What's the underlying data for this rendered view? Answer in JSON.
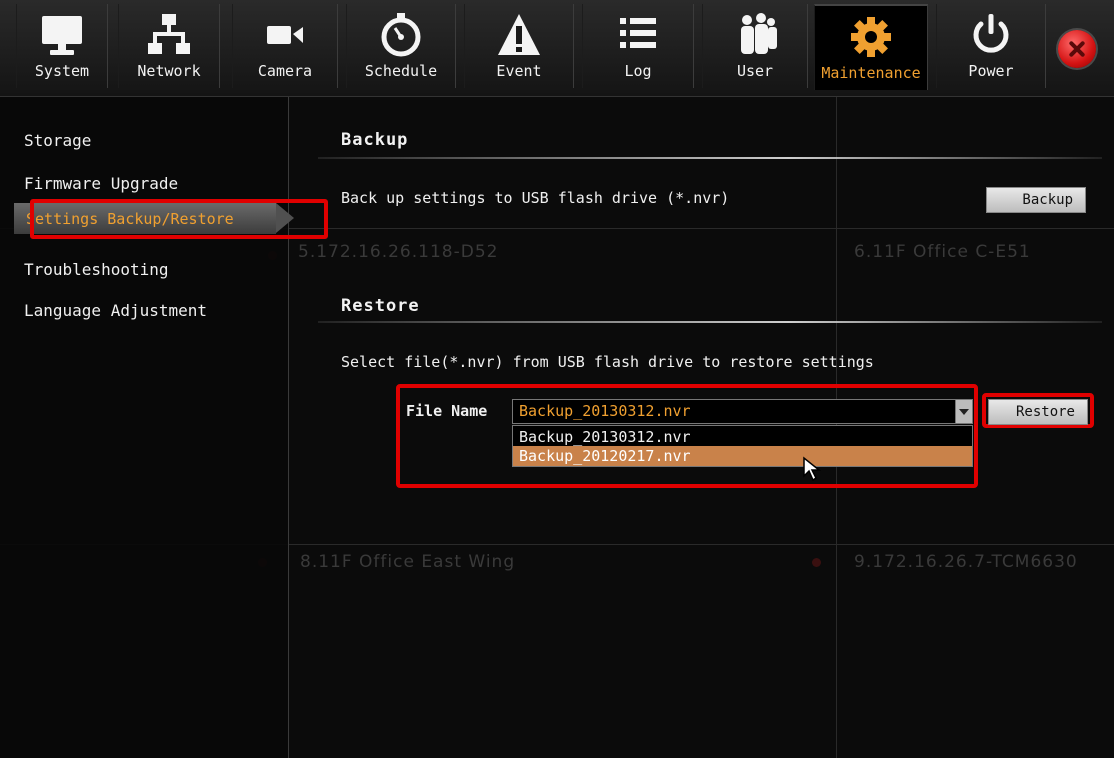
{
  "toolbar": {
    "items": [
      {
        "label": "System",
        "icon": "monitor-icon"
      },
      {
        "label": "Network",
        "icon": "network-icon"
      },
      {
        "label": "Camera",
        "icon": "camera-icon"
      },
      {
        "label": "Schedule",
        "icon": "stopwatch-icon"
      },
      {
        "label": "Event",
        "icon": "warning-icon"
      },
      {
        "label": "Log",
        "icon": "list-icon"
      },
      {
        "label": "User",
        "icon": "users-icon"
      },
      {
        "label": "Maintenance",
        "icon": "gear-icon",
        "active": true
      },
      {
        "label": "Power",
        "icon": "power-icon"
      }
    ],
    "close_icon": "close-icon"
  },
  "sidebar": {
    "items": [
      {
        "label": "Storage"
      },
      {
        "label": "Firmware Upgrade"
      },
      {
        "label": "Settings Backup/Restore",
        "active": true
      },
      {
        "label": "Troubleshooting"
      },
      {
        "label": "Language Adjustment"
      }
    ]
  },
  "background_cameras": [
    "5.172.16.26.118-D52",
    "6.11F Office C-E51",
    "8.11F Office East Wing",
    "9.172.16.26.7-TCM6630"
  ],
  "backup": {
    "title": "Backup",
    "description": "Back up settings to USB flash drive (*.nvr)",
    "button_label": "Backup"
  },
  "restore": {
    "title": "Restore",
    "description": "Select file(*.nvr) from USB flash drive to restore settings",
    "file_label": "File Name",
    "selected_file": "Backup_20130312.nvr",
    "options": [
      "Backup_20130312.nvr",
      "Backup_20120217.nvr"
    ],
    "highlighted_option": "Backup_20120217.nvr",
    "button_label": "Restore"
  },
  "colors": {
    "accent": "#f0a030",
    "highlight_border": "#e00000",
    "selected_option": "#c9824a"
  }
}
